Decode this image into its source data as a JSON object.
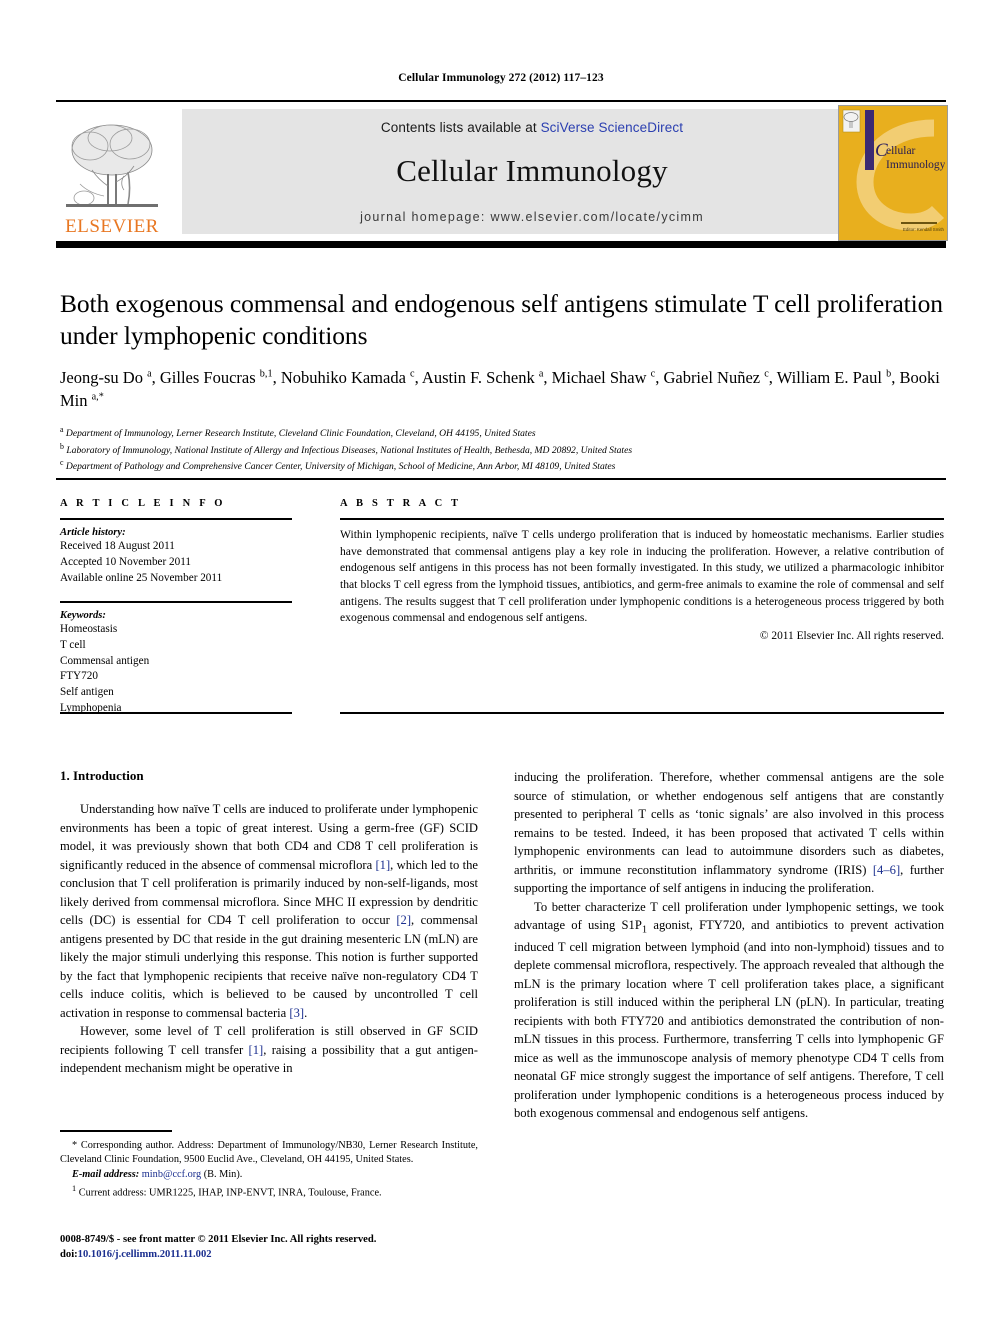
{
  "running_head": "Cellular Immunology 272 (2012) 117–123",
  "masthead": {
    "publisher_name": "ELSEVIER",
    "contents_prefix": "Contents lists available at ",
    "contents_link": "SciVerse ScienceDirect",
    "journal_title": "Cellular Immunology",
    "homepage_label": "journal homepage: www.elsevier.com/locate/ycimm",
    "cover_title_line1": "ellular",
    "cover_title_line2": "Immunology",
    "cover_color": "#E8AF1E",
    "accent_link_color": "#2b3fb0",
    "elsevier_orange": "#E87722"
  },
  "article": {
    "title": "Both exogenous commensal and endogenous self antigens stimulate T cell proliferation under lymphopenic conditions",
    "authors_html": "Jeong-su Do <sup>a</sup>, Gilles Foucras <sup>b,1</sup>, Nobuhiko Kamada <sup>c</sup>, Austin F. Schenk <sup>a</sup>, Michael Shaw <sup>c</sup>, Gabriel Nuñez <sup>c</sup>, William E. Paul <sup>b</sup>, Booki Min <sup>a,*</sup>",
    "affiliations": [
      "Department of Immunology, Lerner Research Institute, Cleveland Clinic Foundation, Cleveland, OH 44195, United States",
      "Laboratory of Immunology, National Institute of Allergy and Infectious Diseases, National Institutes of Health, Bethesda, MD 20892, United States",
      "Department of Pathology and Comprehensive Cancer Center, University of Michigan, School of Medicine, Ann Arbor, MI 48109, United States"
    ],
    "affiliation_marks": [
      "a",
      "b",
      "c"
    ]
  },
  "info": {
    "heading": "A R T I C L E   I N F O",
    "history_label": "Article history:",
    "history": [
      "Received 18 August 2011",
      "Accepted 10 November 2011",
      "Available online 25 November 2011"
    ],
    "keywords_label": "Keywords:",
    "keywords": [
      "Homeostasis",
      "T cell",
      "Commensal antigen",
      "FTY720",
      "Self antigen",
      "Lymphopenia"
    ]
  },
  "abstract": {
    "heading": "A B S T R A C T",
    "text": "Within lymphopenic recipients, naïve T cells undergo proliferation that is induced by homeostatic mechanisms. Earlier studies have demonstrated that commensal antigens play a key role in inducing the proliferation. However, a relative contribution of endogenous self antigens in this process has not been formally investigated. In this study, we utilized a pharmacologic inhibitor that blocks T cell egress from the lymphoid tissues, antibiotics, and germ-free animals to examine the role of commensal and self antigens. The results suggest that T cell proliferation under lymphopenic conditions is a heterogeneous process triggered by both exogenous commensal and endogenous self antigens.",
    "copyright": "© 2011 Elsevier Inc. All rights reserved."
  },
  "body": {
    "section_heading": "1. Introduction",
    "left_paragraphs": [
      "Understanding how naïve T cells are induced to proliferate under lymphopenic environments has been a topic of great interest. Using a germ-free (GF) SCID model, it was previously shown that both CD4 and CD8 T cell proliferation is significantly reduced in the absence of commensal microflora [1], which led to the conclusion that T cell proliferation is primarily induced by non-self-ligands, most likely derived from commensal microflora. Since MHC II expression by dendritic cells (DC) is essential for CD4 T cell proliferation to occur [2], commensal antigens presented by DC that reside in the gut draining mesenteric LN (mLN) are likely the major stimuli underlying this response. This notion is further supported by the fact that lymphopenic recipients that receive naïve non-regulatory CD4 T cells induce colitis, which is believed to be caused by uncontrolled T cell activation in response to commensal bacteria [3].",
      "However, some level of T cell proliferation is still observed in GF SCID recipients following T cell transfer [1], raising a possibility that a gut antigen-independent mechanism might be operative in"
    ],
    "right_paragraphs": [
      "inducing the proliferation. Therefore, whether commensal antigens are the sole source of stimulation, or whether endogenous self antigens that are constantly presented to peripheral T cells as ‘tonic signals’ are also involved in this process remains to be tested. Indeed, it has been proposed that activated T cells within lymphopenic environments can lead to autoimmune disorders such as diabetes, arthritis, or immune reconstitution inflammatory syndrome (IRIS) [4–6], further supporting the importance of self antigens in inducing the proliferation.",
      "To better characterize T cell proliferation under lymphopenic settings, we took advantage of using S1P₁ agonist, FTY720, and antibiotics to prevent activation induced T cell migration between lymphoid (and into non-lymphoid) tissues and to deplete commensal microflora, respectively. The approach revealed that although the mLN is the primary location where T cell proliferation takes place, a significant proliferation is still induced within the peripheral LN (pLN). In particular, treating recipients with both FTY720 and antibiotics demonstrated the contribution of non-mLN tissues in this process. Furthermore, transferring T cells into lymphopenic GF mice as well as the immunoscope analysis of memory phenotype CD4 T cells from neonatal GF mice strongly suggest the importance of self antigens. Therefore, T cell proliferation under lymphopenic conditions is a heterogeneous process induced by both exogenous commensal and endogenous self antigens."
    ],
    "reference_marks": [
      "[1]",
      "[2]",
      "[3]",
      "[1]",
      "[4–6]"
    ]
  },
  "footnotes": {
    "corresponding": "Corresponding author. Address: Department of Immunology/NB30, Lerner Research Institute, Cleveland Clinic Foundation, 9500 Euclid Ave., Cleveland, OH 44195, United States.",
    "corresponding_mark": "*",
    "email_label": "E-mail address:",
    "email": "minb@ccf.org",
    "email_suffix": "(B. Min).",
    "current_address_mark": "1",
    "current_address": "Current address: UMR1225, IHAP, INP-ENVT, INRA, Toulouse, France."
  },
  "footer": {
    "issn_line": "0008-8749/$ - see front matter © 2011 Elsevier Inc. All rights reserved.",
    "doi_label": "doi:",
    "doi": "10.1016/j.cellimm.2011.11.002"
  }
}
